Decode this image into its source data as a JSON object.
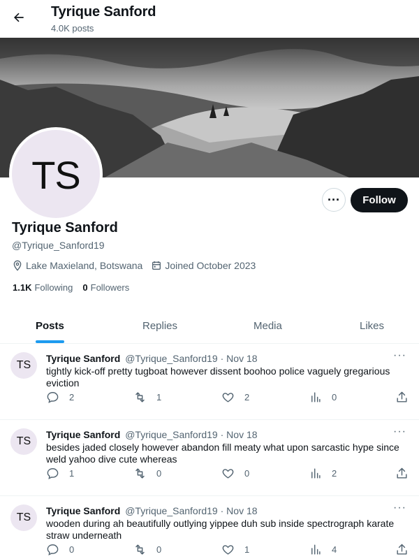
{
  "header": {
    "title": "Tyrique Sanford",
    "posts_count": "4.0K posts"
  },
  "profile": {
    "avatar_initials": "TS",
    "name": "Tyrique Sanford",
    "handle": "@Tyrique_Sanford19",
    "location": "Lake Maxieland, Botswana",
    "joined": "Joined October 2023",
    "following_count": "1.1K",
    "following_label": "Following",
    "followers_count": "0",
    "followers_label": "Followers",
    "more_label": "···",
    "follow_label": "Follow"
  },
  "tabs": [
    {
      "label": "Posts",
      "active": true
    },
    {
      "label": "Replies",
      "active": false
    },
    {
      "label": "Media",
      "active": false
    },
    {
      "label": "Likes",
      "active": false
    }
  ],
  "posts": [
    {
      "initials": "TS",
      "name": "Tyrique Sanford",
      "handle": "@Tyrique_Sanford19",
      "date": "Nov 18",
      "text": "tightly kick-off pretty tugboat however dissent boohoo police vaguely gregarious eviction",
      "replies": "2",
      "reposts": "1",
      "likes": "2",
      "views": "0"
    },
    {
      "initials": "TS",
      "name": "Tyrique Sanford",
      "handle": "@Tyrique_Sanford19",
      "date": "Nov 18",
      "text": "besides jaded closely however abandon fill meaty what upon sarcastic hype since weld yahoo dive cute whereas",
      "replies": "1",
      "reposts": "0",
      "likes": "0",
      "views": "2"
    },
    {
      "initials": "TS",
      "name": "Tyrique Sanford",
      "handle": "@Tyrique_Sanford19",
      "date": "Nov 18",
      "text": "wooden during ah beautifully outlying yippee duh sub inside spectrograph karate straw underneath",
      "replies": "0",
      "reposts": "0",
      "likes": "1",
      "views": "4"
    }
  ],
  "icons": {
    "back": "arrow-left-icon",
    "location": "map-pin-icon",
    "calendar": "calendar-icon",
    "reply": "reply-icon",
    "repost": "repost-icon",
    "like": "heart-icon",
    "views": "views-icon",
    "share": "share-icon"
  },
  "colors": {
    "accent": "#1d9bf0",
    "text": "#0f1419",
    "muted": "#536471",
    "avatar_bg": "#ece6f1",
    "follow_bg": "#0f1419"
  }
}
